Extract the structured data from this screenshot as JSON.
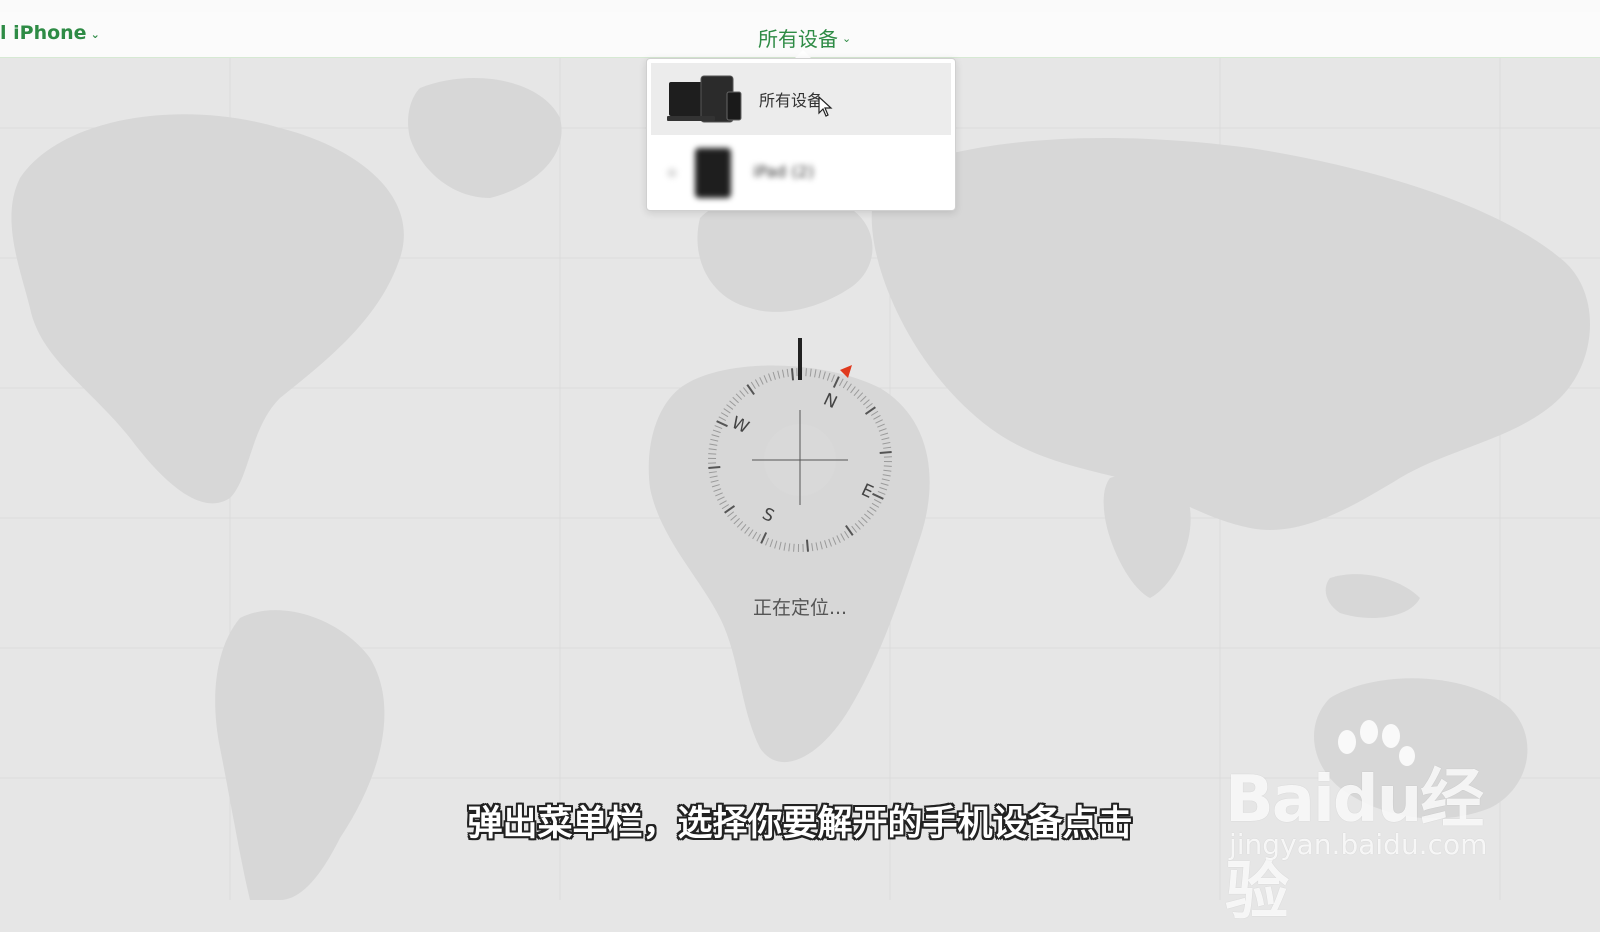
{
  "header": {
    "app_title": "l iPhone",
    "device_menu_label": "所有设备"
  },
  "dropdown": {
    "items": [
      {
        "label": "所有设备",
        "icon": "all-devices-icon",
        "selected": true
      },
      {
        "label": "iPad (2)",
        "status": "",
        "icon": "ipad-icon",
        "blurred": true
      }
    ]
  },
  "status": {
    "locating_text": "正在定位..."
  },
  "compass": {
    "labels": {
      "n": "N",
      "e": "E",
      "s": "S",
      "w": "W"
    }
  },
  "subtitle": "弹出菜单栏，选择你要解开的手机设备点击",
  "watermark": {
    "brand": "Baidu经验",
    "domain": "jingyan.baidu.com"
  },
  "colors": {
    "accent_green": "#2e8b45",
    "compass_red": "#e03a1e",
    "map_bg": "#e6e6e6"
  }
}
